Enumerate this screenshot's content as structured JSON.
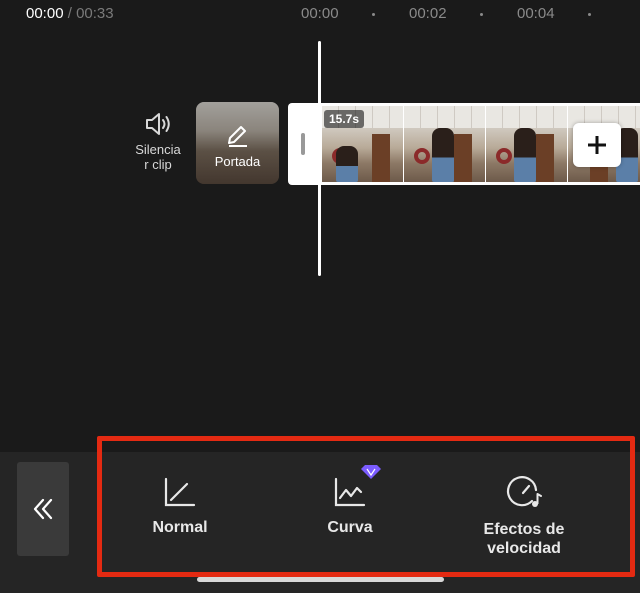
{
  "player": {
    "current_time": "00:00",
    "separator": " / ",
    "total_time": "00:33"
  },
  "ruler": {
    "ticks": [
      "00:00",
      "00:02",
      "00:04"
    ]
  },
  "timeline": {
    "mute_label": "Silencia\nr clip",
    "mute_icon": "speaker-icon",
    "cover_label": "Portada",
    "cover_icon": "pencil-icon",
    "clip_duration": "15.7s",
    "add_icon": "plus-icon"
  },
  "toolbar": {
    "back_icon": "double-chevron-left-icon",
    "tools": [
      {
        "label": "Normal",
        "icon": "normal-speed-icon"
      },
      {
        "label": "Curva",
        "icon": "curve-speed-icon",
        "badge_icon": "diamond-icon"
      },
      {
        "label": "Efectos de\nvelocidad",
        "icon": "speed-effects-icon"
      }
    ]
  },
  "colors": {
    "background": "#1a1a1a",
    "toolbar": "#252525",
    "highlight": "#e42a12",
    "pro_badge": "#7b5cff"
  }
}
